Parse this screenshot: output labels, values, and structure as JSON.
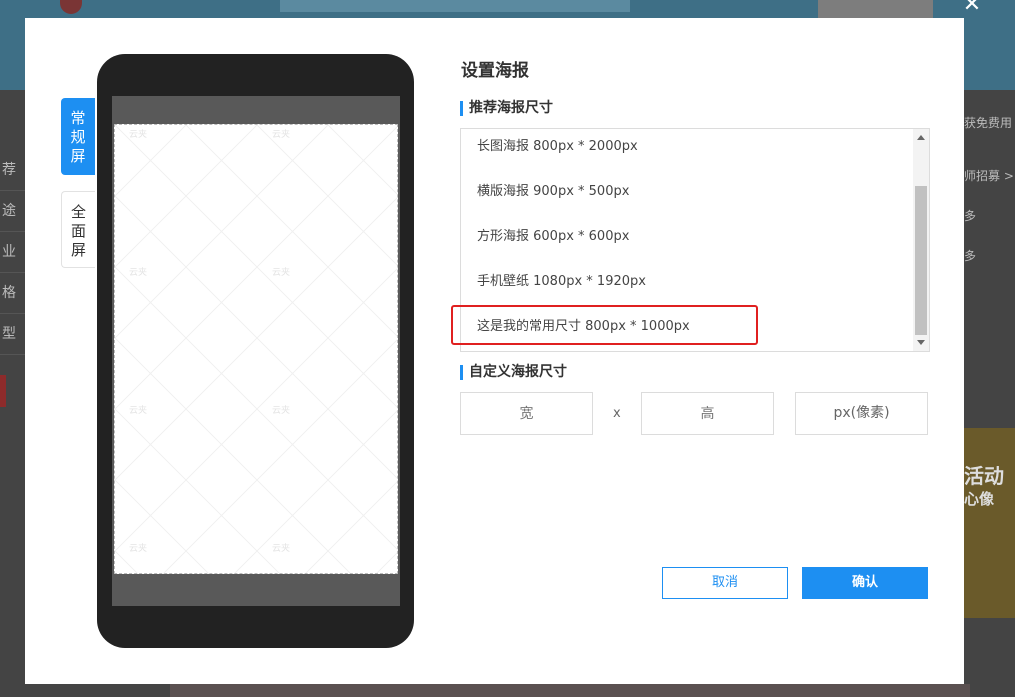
{
  "background": {
    "left_nav": [
      "荐",
      "途",
      "业",
      "格",
      "型"
    ],
    "right_texts": [
      "师招募 >",
      "多",
      "多",
      "获免费用",
      "活动",
      "心像"
    ]
  },
  "modal": {
    "title": "设置海报",
    "tabs": [
      {
        "label": [
          "常",
          "规",
          "屏"
        ],
        "active": true
      },
      {
        "label": [
          "全",
          "面",
          "屏"
        ],
        "active": false
      }
    ],
    "watermark_text": "云夹",
    "recommended": {
      "label": "推荐海报尺寸",
      "items": [
        "长图海报 800px * 2000px",
        "横版海报 900px * 500px",
        "方形海报 600px * 600px",
        "手机壁纸 1080px * 1920px",
        "这是我的常用尺寸 800px * 1000px"
      ]
    },
    "custom": {
      "label": "自定义海报尺寸",
      "width_placeholder": "宽",
      "height_placeholder": "高",
      "times": "x",
      "unit": "px(像素)"
    },
    "buttons": {
      "cancel": "取消",
      "confirm": "确认"
    }
  },
  "colors": {
    "accent": "#1d8ff2",
    "highlight": "#e02020"
  }
}
